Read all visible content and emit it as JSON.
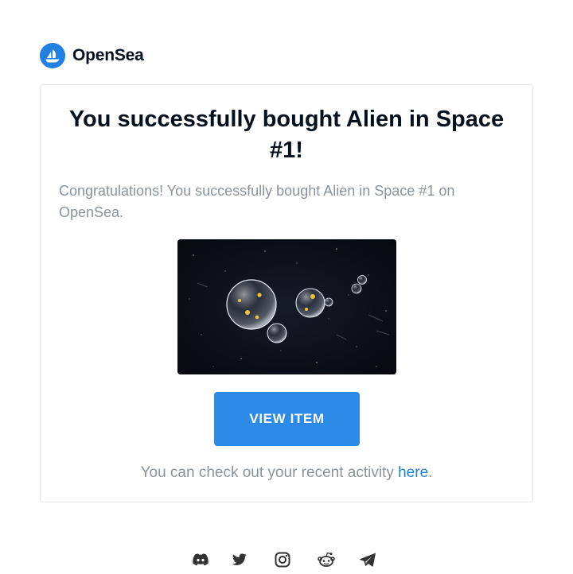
{
  "brand": {
    "name": "OpenSea",
    "logo_icon": "opensea-sailboat-icon",
    "color": "#2081e2"
  },
  "email": {
    "title": "You successfully bought Alien in Space #1!",
    "message": "Congratulations! You successfully bought Alien in Space #1 on OpenSea.",
    "view_button_label": "VIEW ITEM",
    "activity_text": "You can check out your recent activity ",
    "activity_link_text": "here",
    "activity_suffix": "."
  },
  "nft": {
    "image_icon": "space-bubbles-image"
  },
  "footer": {
    "social_icons": [
      "discord-icon",
      "twitter-icon",
      "instagram-icon",
      "reddit-icon",
      "telegram-icon"
    ]
  },
  "colors": {
    "primary": "#2d8ae6",
    "link": "#2081e2",
    "muted_text": "#8a939b",
    "heading": "#04111d",
    "border": "#e5e8eb"
  }
}
